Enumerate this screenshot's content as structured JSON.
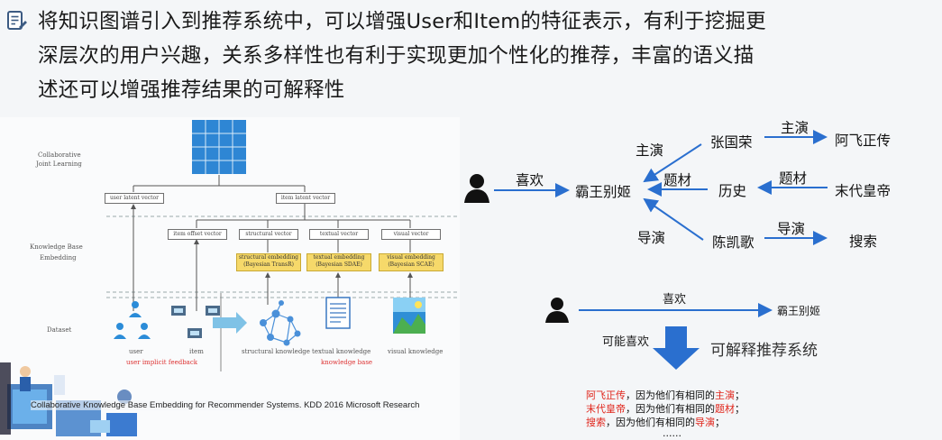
{
  "header": {
    "line1": "将知识图谱引入到推荐系统中，可以增强User和Item的特征表示，有利于挖掘更",
    "line2": "深层次的用户兴趣，关系多样性也有利于实现更加个性化的推荐，丰富的语义描",
    "line3": "述还可以增强推荐结果的可解释性"
  },
  "figure": {
    "cjl_title_1": "Collaborative",
    "cjl_title_2": "Joint Learning",
    "kbe_title_1": "Knowledge Base",
    "kbe_title_2": "Embedding",
    "dataset_title": "Dataset",
    "user_latent": "user latent vector",
    "item_latent": "item latent vector",
    "item_offset": "item offset vector",
    "structural_vector": "structural vector",
    "textual_vector": "textual vector",
    "visual_vector": "visual vector",
    "structural_emb_1": "structural embedding",
    "structural_emb_2": "(Bayesian TransR)",
    "textual_emb_1": "textual embedding",
    "textual_emb_2": "(Bayesian SDAE)",
    "visual_emb_1": "visual embedding",
    "visual_emb_2": "(Bayesian SCAE)",
    "user_label": "user",
    "item_label": "item",
    "structural_knowledge": "structural knowledge",
    "textual_knowledge": "textual knowledge",
    "visual_knowledge": "visual knowledge",
    "implicit_feedback": "user implicit feedback",
    "knowledge_base": "knowledge base",
    "citation": "Collaborative Knowledge Base Embedding for Recommender Systems. KDD 2016  Microsoft Research"
  },
  "kg": {
    "likes": "喜欢",
    "movie": "霸王别姬",
    "lead_1": "主演",
    "zhang": "张国荣",
    "lead_2": "主演",
    "afei": "阿飞正传",
    "genre_1": "题材",
    "history": "历史",
    "genre_2": "题材",
    "lastemperor": "末代皇帝",
    "director_1": "导演",
    "chen": "陈凯歌",
    "director_2": "导演",
    "search": "搜索"
  },
  "explain": {
    "likes": "喜欢",
    "movie": "霸王别姬",
    "may_like": "可能喜欢",
    "system": "可解释推荐系统",
    "r1_item": "阿飞正传",
    "r1_text": "，因为他们有相同的",
    "r1_rel": "主演",
    "r1_end": "；",
    "r2_item": "末代皇帝",
    "r2_text": "，因为他们有相同的",
    "r2_rel": "题材",
    "r2_end": "；",
    "r3_item": "搜索",
    "r3_text": "，因为他们有相同的",
    "r3_rel": "导演",
    "r3_end": "；",
    "ellipsis": "......"
  },
  "colors": {
    "arrow_blue": "#2a6fcf",
    "highlight_red": "#e0251b",
    "matrix_blue": "#2e86d4",
    "embed_yellow": "#f6d96a"
  }
}
